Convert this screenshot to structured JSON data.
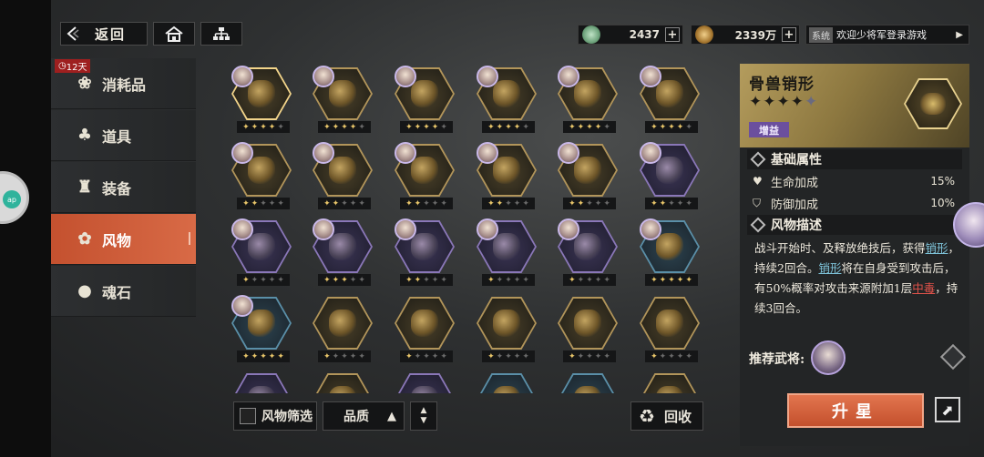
{
  "topbar": {
    "back_label": "返回",
    "jade_value": "2437",
    "coin_value": "2339万",
    "sys_tag": "系统",
    "sys_message": "欢迎少将军登录游戏"
  },
  "sidebar": {
    "badge": "12天",
    "items": [
      {
        "label": "消耗品",
        "icon": "bag-icon"
      },
      {
        "label": "道具",
        "icon": "gourd-icon"
      },
      {
        "label": "装备",
        "icon": "armor-icon"
      },
      {
        "label": "风物",
        "icon": "scenery-icon"
      },
      {
        "label": "魂石",
        "icon": "soul-stone-icon"
      }
    ],
    "active_index": 3
  },
  "grid": {
    "rows": [
      [
        {
          "q": "gold",
          "stars": 4,
          "sel": true
        },
        {
          "q": "gold",
          "stars": 4
        },
        {
          "q": "gold",
          "stars": 4
        },
        {
          "q": "gold",
          "stars": 4
        },
        {
          "q": "gold",
          "stars": 4
        },
        {
          "q": "gold",
          "stars": 4
        }
      ],
      [
        {
          "q": "gold",
          "stars": 2
        },
        {
          "q": "gold",
          "stars": 2
        },
        {
          "q": "gold",
          "stars": 2
        },
        {
          "q": "gold",
          "stars": 2
        },
        {
          "q": "gold",
          "stars": 2
        },
        {
          "q": "purple",
          "stars": 2
        }
      ],
      [
        {
          "q": "purple",
          "stars": 1
        },
        {
          "q": "purple",
          "stars": 3
        },
        {
          "q": "purple",
          "stars": 2
        },
        {
          "q": "purple",
          "stars": 1
        },
        {
          "q": "purple",
          "stars": 1
        },
        {
          "q": "blue",
          "stars": 5
        }
      ],
      [
        {
          "q": "blue",
          "stars": 5
        },
        {
          "q": "gold",
          "stars": 1
        },
        {
          "q": "gold",
          "stars": 1
        },
        {
          "q": "gold",
          "stars": 1
        },
        {
          "q": "gold",
          "stars": 1
        },
        {
          "q": "gold",
          "stars": 1
        }
      ],
      [
        {
          "q": "purple",
          "stars": 0
        },
        {
          "q": "gold",
          "stars": 0
        },
        {
          "q": "purple",
          "stars": 0
        },
        {
          "q": "blue",
          "stars": 0
        },
        {
          "q": "blue",
          "stars": 0
        },
        {
          "q": "gold",
          "stars": 0
        }
      ]
    ]
  },
  "controls": {
    "filter_label": "风物筛选",
    "sort_label": "品质",
    "recycle_label": "回收"
  },
  "detail": {
    "title": "骨兽销形",
    "stars_filled": 4,
    "stars_total": 5,
    "tag": "增益",
    "basic_header": "基础属性",
    "stats": [
      {
        "label": "生命加成",
        "value": "15%"
      },
      {
        "label": "防御加成",
        "value": "10%"
      }
    ],
    "desc_header": "风物描述",
    "desc_parts": [
      {
        "t": "战斗开始时、及释放绝技后，获得"
      },
      {
        "t": "销形",
        "style": "hl"
      },
      {
        "t": "，持续2回合。"
      },
      {
        "t": "销形",
        "style": "hl"
      },
      {
        "t": "将在自身受到攻击后，有50%概率对攻击来源附加1层"
      },
      {
        "t": "中毒",
        "style": "red"
      },
      {
        "t": "，持续3回合。"
      }
    ],
    "recommend_label": "推荐武将:",
    "upstar_label": "升星"
  },
  "colors": {
    "accent": "#d86a46",
    "gold": "#b2955a",
    "purple": "#8a77b8",
    "blue": "#5a8fa8"
  }
}
